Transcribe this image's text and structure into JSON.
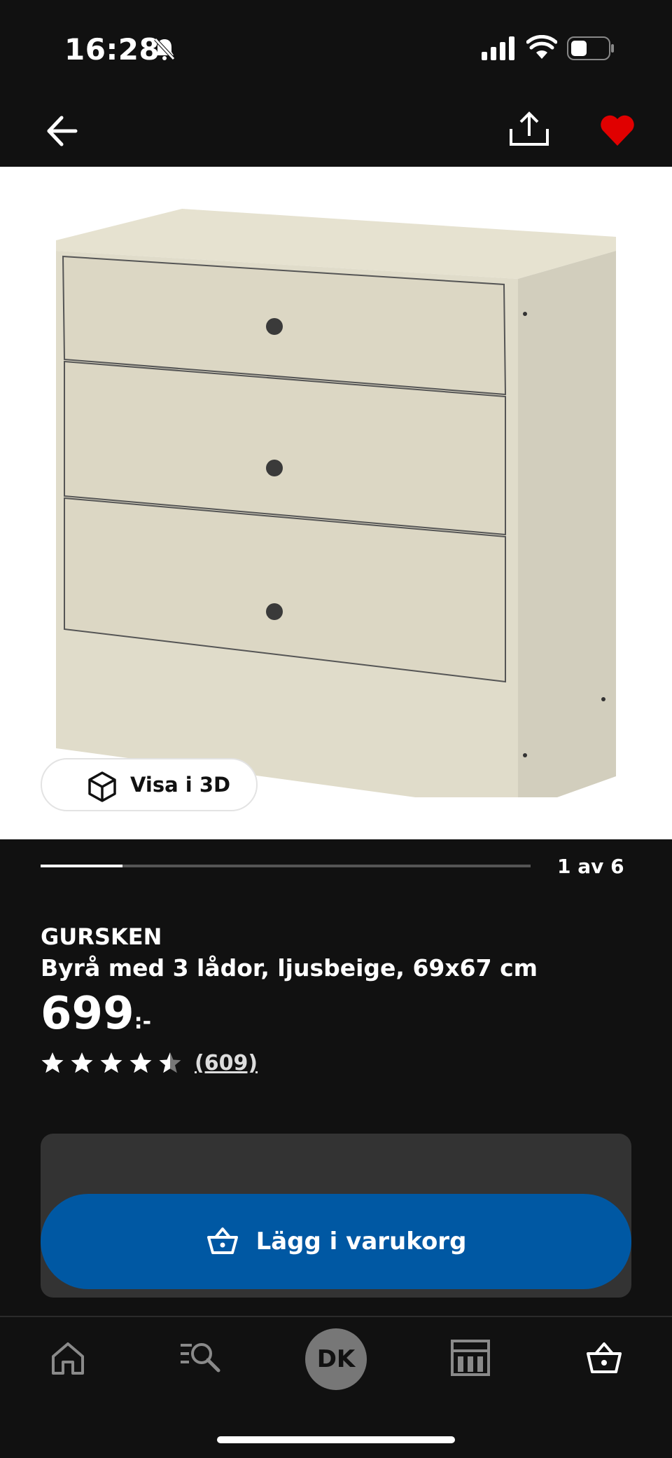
{
  "status_bar": {
    "time": "16:28",
    "icons": [
      "bell-slash-icon",
      "cellular-signal-icon",
      "wifi-icon",
      "battery-icon"
    ]
  },
  "header": {
    "icons": [
      "back-arrow-icon",
      "share-icon",
      "heart-icon"
    ],
    "favorite_color": "#e00000"
  },
  "gallery": {
    "view_3d_label": "Visa i 3D",
    "pager_text": "1 av 6",
    "progress_fraction": 0.167
  },
  "product": {
    "brand": "GURSKEN",
    "description": "Byrå med 3 lådor, ljusbeige, 69x67 cm",
    "price": "699",
    "price_suffix": ":-",
    "rating": 4.5,
    "reviews_text": "(609)"
  },
  "cta": {
    "add_to_cart_label": "Lägg i varukorg",
    "color": "#0058a3"
  },
  "tabbar": {
    "profile_initials": "DK",
    "items": [
      "home-icon",
      "search-list-icon",
      "profile-avatar",
      "store-icon",
      "cart-icon"
    ]
  }
}
